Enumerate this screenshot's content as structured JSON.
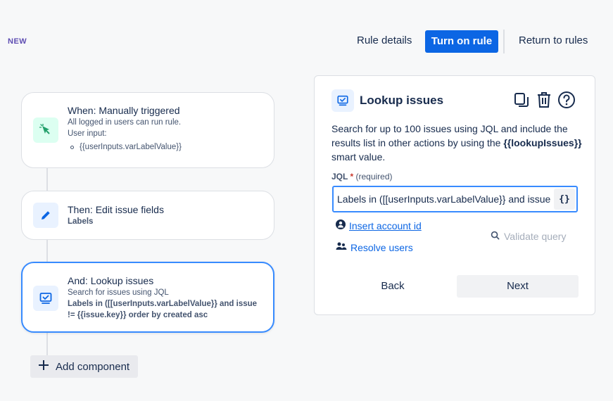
{
  "badge": "NEW",
  "header": {
    "rule_details": "Rule details",
    "turn_on_rule": "Turn on rule",
    "return_to_rules": "Return to rules"
  },
  "flow": {
    "trigger": {
      "title": "When: Manually triggered",
      "line1": "All logged in users can run rule.",
      "line2": "User input:",
      "bullet": "{{userInputs.varLabelValue}}"
    },
    "edit": {
      "title": "Then: Edit issue fields",
      "detail": "Labels"
    },
    "lookup": {
      "title": "And: Lookup issues",
      "line1": "Search for issues using JQL",
      "query_line1": "Labels in ([[userInputs.varLabelValue}} and issue",
      "query_line2": "!= {{issue.key}} order by created asc"
    },
    "add_component": "Add component"
  },
  "panel": {
    "title": "Lookup issues",
    "desc_part1": "Search for up to 100 issues using JQL and include the results list in other actions by using the ",
    "desc_smart": "{{lookupIssues}}",
    "desc_part2": " smart value.",
    "jql_label": "JQL",
    "required_mark": "*",
    "required_text": "(required)",
    "jql_value": "Labels in ([[userInputs.varLabelValue}} and issue != {{issue.key}} order by created asc",
    "braces": "{}",
    "insert_account": " Insert account id",
    "resolve_users": "Resolve users",
    "validate_query": "Validate query",
    "back": "Back",
    "next": "Next"
  },
  "colors": {
    "primary": "#0c66e4",
    "active_border": "#388bff",
    "trigger_icon_bg": "#dcfff1",
    "trigger_icon": "#22a06b",
    "action_icon_bg": "#e9f2ff",
    "action_icon": "#0c66e4"
  }
}
